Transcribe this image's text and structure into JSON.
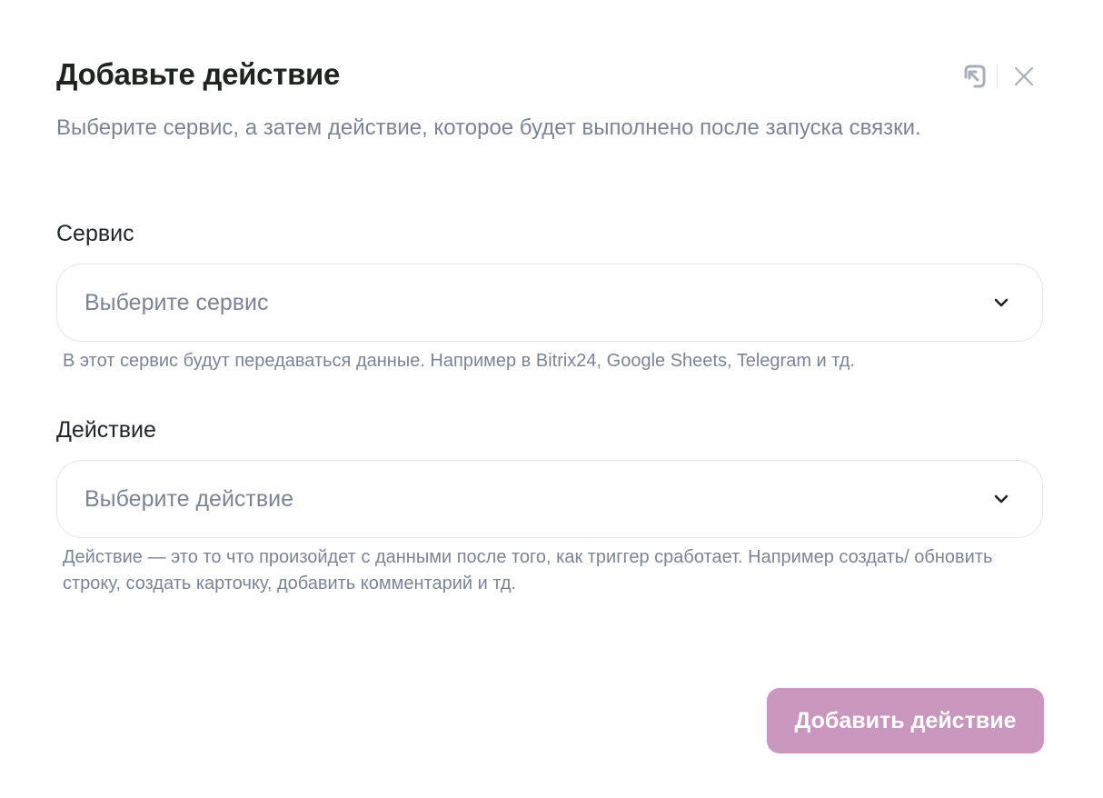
{
  "modal": {
    "title": "Добавьте действие",
    "subtitle": "Выберите сервис, а затем действие, которое будет выполнено после запуска связки.",
    "icons": {
      "pin": "external-arrow-icon",
      "close": "close-icon"
    }
  },
  "service": {
    "label": "Сервис",
    "placeholder": "Выберите сервис",
    "hint": "В этот сервис будут передаваться данные. Например в Bitrix24, Google Sheets, Telegram и тд."
  },
  "action": {
    "label": "Действие",
    "placeholder": "Выберите действие",
    "hint": "Действие — это то что произойдет с данными после того, как триггер сработает. Например создать/ обновить строку, создать карточку, добавить комментарий и тд."
  },
  "submit_label": "Добавить действие",
  "colors": {
    "accent": "#c996be",
    "text_primary": "#1f2421",
    "text_muted": "#7b8497",
    "border": "#e4e7eb"
  }
}
